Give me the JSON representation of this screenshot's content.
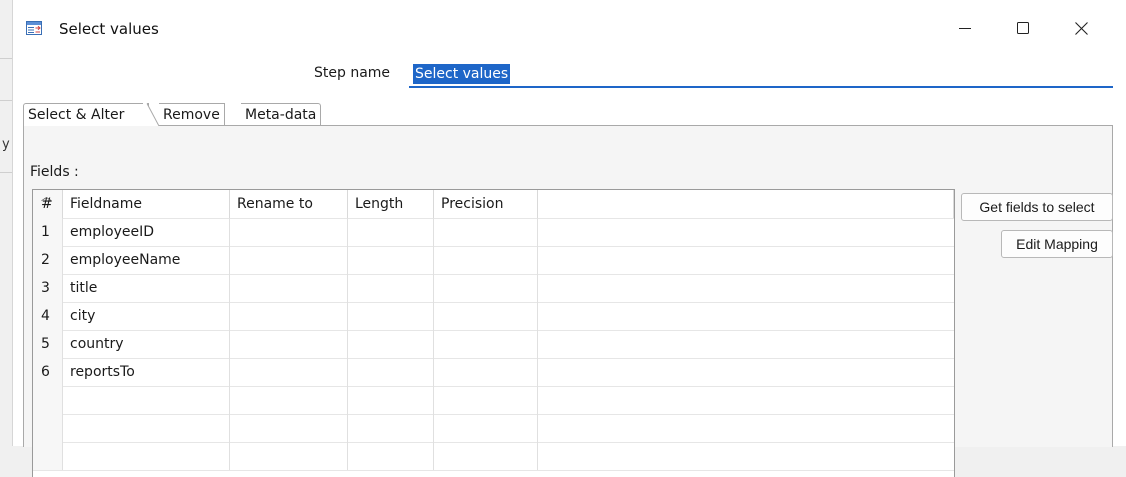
{
  "window": {
    "title": "Select values",
    "edge_text": "y"
  },
  "step_name": {
    "label": "Step name",
    "value": "Select values"
  },
  "tabs": [
    {
      "label": "Select & Alter",
      "active": true
    },
    {
      "label": "Remove",
      "active": false
    },
    {
      "label": "Meta-data",
      "active": false
    }
  ],
  "fields_label": "Fields :",
  "table": {
    "columns": [
      "#",
      "Fieldname",
      "Rename to",
      "Length",
      "Precision"
    ],
    "rows": [
      {
        "num": "1",
        "fieldname": "employeeID",
        "rename": "",
        "length": "",
        "precision": ""
      },
      {
        "num": "2",
        "fieldname": "employeeName",
        "rename": "",
        "length": "",
        "precision": ""
      },
      {
        "num": "3",
        "fieldname": "title",
        "rename": "",
        "length": "",
        "precision": ""
      },
      {
        "num": "4",
        "fieldname": "city",
        "rename": "",
        "length": "",
        "precision": ""
      },
      {
        "num": "5",
        "fieldname": "country",
        "rename": "",
        "length": "",
        "precision": ""
      },
      {
        "num": "6",
        "fieldname": "reportsTo",
        "rename": "",
        "length": "",
        "precision": ""
      }
    ]
  },
  "buttons": {
    "get_fields": "Get fields to select",
    "edit_mapping": "Edit Mapping"
  },
  "icons": {
    "app": "select-values-step-icon",
    "minimize": "minimize-icon",
    "maximize": "maximize-icon",
    "close": "close-icon",
    "sort": "sort-icon"
  },
  "colors": {
    "accent": "#1e66c8",
    "selection_text": "#ffffff"
  }
}
